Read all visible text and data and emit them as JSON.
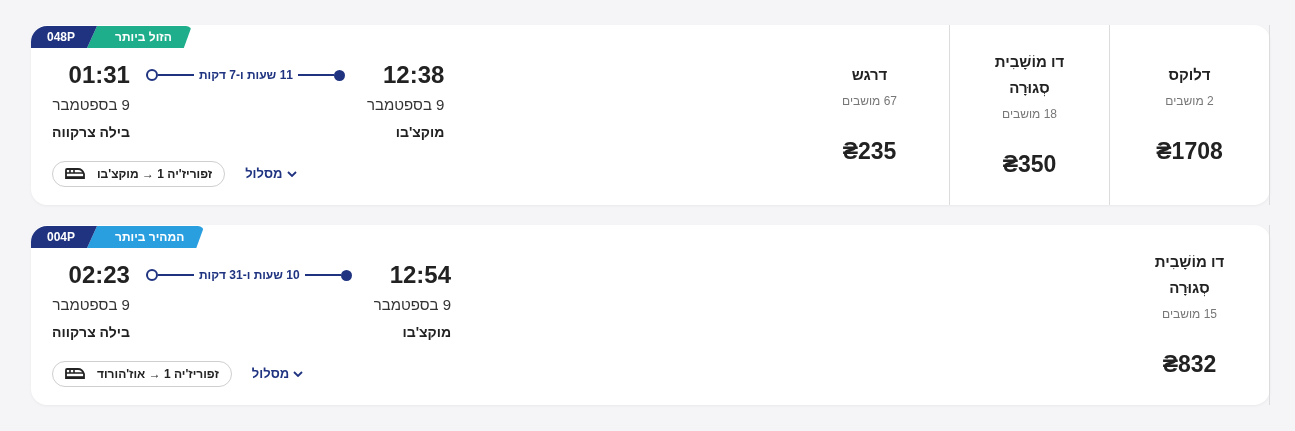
{
  "trains": [
    {
      "number": "048P",
      "badge": {
        "label": "הזול ביותר",
        "kind": "cheapest"
      },
      "departure": {
        "time": "12:38",
        "date": "9 בספטמבר",
        "station": "מוקצ'בו"
      },
      "duration": "11 שעות ו-7 דקות",
      "arrival": {
        "time": "01:31",
        "date": "9 בספטמבר",
        "station": "בילה צרקווה"
      },
      "route_label": "מסלול",
      "route_chip": "זפוריז'יה 1 → מוקצ'בו",
      "fares": [
        {
          "name": "דלוקס",
          "seats": "2 מושבים",
          "price": "₴1708"
        },
        {
          "name": "דו מוֹשָׁבִית סְגוּרָה",
          "seats": "18 מושבים",
          "price": "₴350"
        },
        {
          "name": "דרגש",
          "seats": "67 מושבים",
          "price": "₴235"
        }
      ]
    },
    {
      "number": "004P",
      "badge": {
        "label": "המהיר ביותר",
        "kind": "fastest"
      },
      "departure": {
        "time": "12:54",
        "date": "9 בספטמבר",
        "station": "מוקצ'בו"
      },
      "duration": "10 שעות ו-31 דקות",
      "arrival": {
        "time": "02:23",
        "date": "9 בספטמבר",
        "station": "בילה צרקווה"
      },
      "route_label": "מסלול",
      "route_chip": "זפוריז'יה 1 → אוז'הורוד",
      "fares": [
        {
          "name": "דו מוֹשָׁבִית סְגוּרָה",
          "seats": "15 מושבים",
          "price": "₴832"
        }
      ]
    }
  ]
}
